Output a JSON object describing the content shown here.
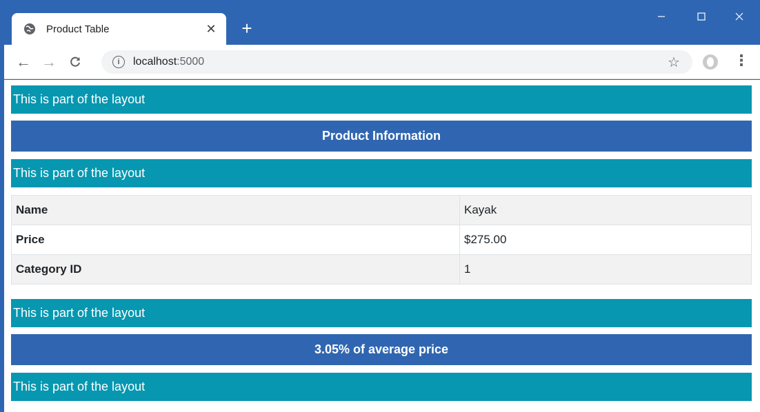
{
  "browser": {
    "tab_title": "Product Table",
    "url_host": "localhost",
    "url_port": ":5000"
  },
  "layout_text": "This is part of the layout",
  "page": {
    "layout_bars": [
      "This is part of the layout",
      "This is part of the layout",
      "This is part of the layout",
      "This is part of the layout"
    ],
    "header": "Product Information",
    "table": [
      {
        "label": "Name",
        "value": "Kayak"
      },
      {
        "label": "Price",
        "value": "$275.00"
      },
      {
        "label": "Category ID",
        "value": "1"
      }
    ],
    "footer": "3.05% of average price"
  },
  "colors": {
    "chrome": "#2f66b3",
    "layout_bar": "#0797b0",
    "header_bar": "#3066b1"
  }
}
